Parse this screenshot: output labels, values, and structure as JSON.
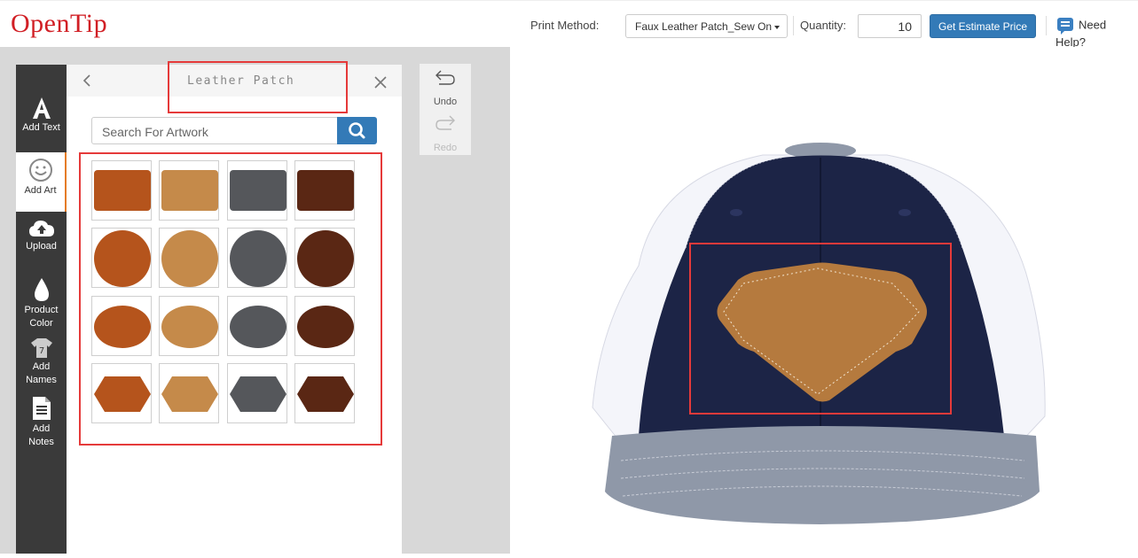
{
  "header": {
    "logo": "OpenTip",
    "print_method_label": "Print Method:",
    "print_method_value": "Faux Leather Patch_Sew On",
    "quantity_label": "Quantity:",
    "quantity_value": "10",
    "estimate_button": "Get Estimate Price",
    "help_label": "Need Help?"
  },
  "rail": {
    "items": [
      {
        "label": "Add Text",
        "icon": "letter-a-icon"
      },
      {
        "label": "Add Art",
        "icon": "smiley-icon",
        "active": true
      },
      {
        "label": "Upload",
        "icon": "cloud-upload-icon"
      },
      {
        "label_line1": "Product",
        "label_line2": "Color",
        "icon": "droplet-icon"
      },
      {
        "label_line1": "Add",
        "label_line2": "Names",
        "icon": "jersey-icon"
      },
      {
        "label_line1": "Add",
        "label_line2": "Notes",
        "icon": "document-icon"
      }
    ]
  },
  "panel": {
    "title": "Leather Patch",
    "search_placeholder": "Search For Artwork"
  },
  "art_tiles": [
    {
      "shape": "rectangle",
      "color": "#b5541c"
    },
    {
      "shape": "rectangle",
      "color": "#c58a4a"
    },
    {
      "shape": "rectangle",
      "color": "#55575b"
    },
    {
      "shape": "rectangle",
      "color": "#5a2714"
    },
    {
      "shape": "circle",
      "color": "#b5541c"
    },
    {
      "shape": "circle",
      "color": "#c58a4a"
    },
    {
      "shape": "circle",
      "color": "#55575b"
    },
    {
      "shape": "circle",
      "color": "#5a2714"
    },
    {
      "shape": "oval",
      "color": "#b5541c"
    },
    {
      "shape": "oval",
      "color": "#c58a4a"
    },
    {
      "shape": "oval",
      "color": "#55575b"
    },
    {
      "shape": "oval",
      "color": "#5a2714"
    },
    {
      "shape": "hexagon",
      "color": "#b5541c"
    },
    {
      "shape": "hexagon",
      "color": "#c58a4a"
    },
    {
      "shape": "hexagon",
      "color": "#55575b"
    },
    {
      "shape": "hexagon",
      "color": "#5a2714"
    }
  ],
  "history": {
    "undo_label": "Undo",
    "redo_label": "Redo"
  },
  "product": {
    "name": "trucker-cap",
    "crown_color": "#1c2446",
    "mesh_color": "#f4f5fa",
    "visor_color": "#8f98a8",
    "patch_color": "#b57a3e"
  },
  "colors": {
    "brand": "#d11f25",
    "accent": "#337ab7",
    "highlight": "#e53a3a",
    "active_tab": "#e57c22"
  }
}
